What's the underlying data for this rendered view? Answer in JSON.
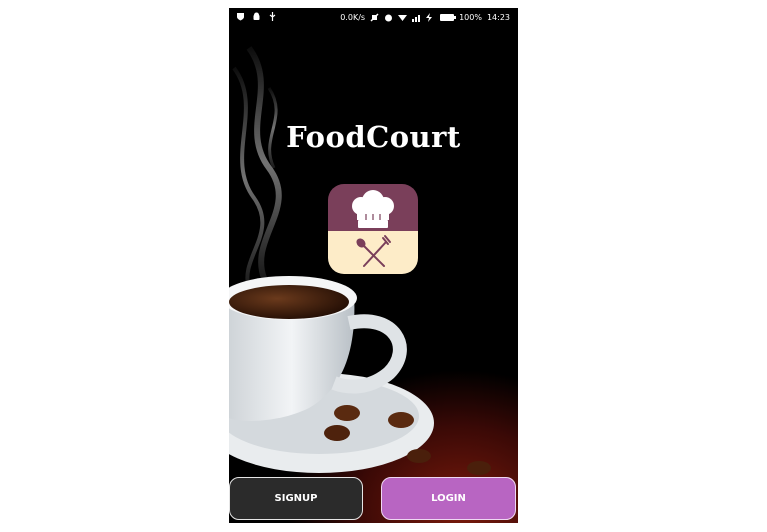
{
  "status_bar": {
    "network_speed": "0.0K/s",
    "battery_percent": "100%",
    "time": "14:23",
    "left_icons": [
      "shield-icon",
      "android-icon",
      "usb-icon"
    ],
    "right_icons": [
      "mute-icon",
      "alarm-icon",
      "wifi-icon",
      "signal-icon",
      "charging-icon",
      "battery-icon"
    ]
  },
  "app": {
    "title": "FoodCourt",
    "logo_icon": "chef-hat-cutlery-logo",
    "colors": {
      "logo_top": "#7a3f5a",
      "logo_bottom": "#fdecc8",
      "signup_bg": "#2b2b2b",
      "login_bg": "#b865c2"
    }
  },
  "buttons": {
    "signup_label": "SIGNUP",
    "login_label": "LOGIN"
  }
}
